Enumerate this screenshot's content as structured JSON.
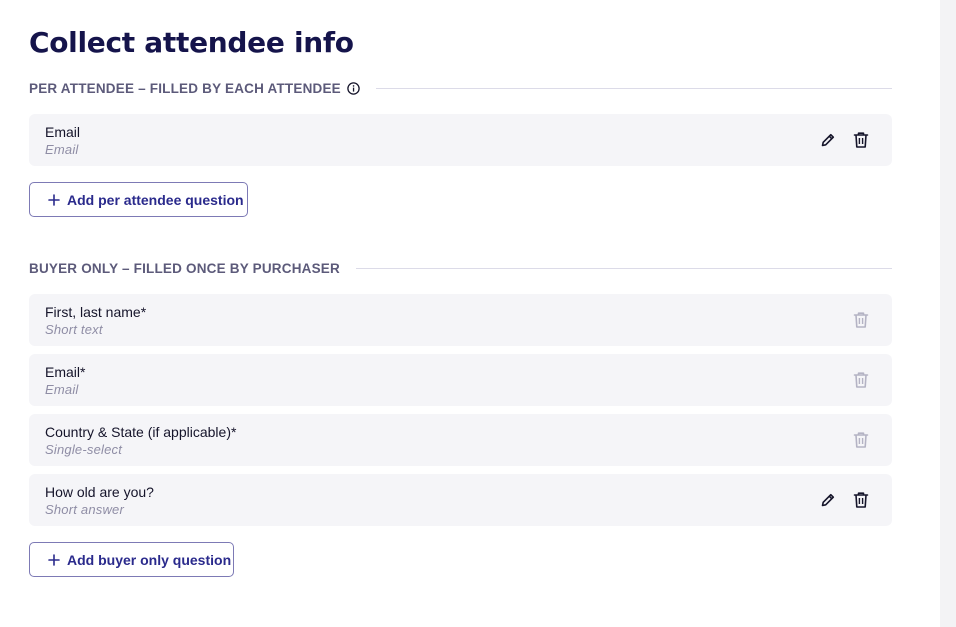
{
  "page": {
    "title": "Collect attendee info"
  },
  "per_attendee": {
    "section_label": "PER ATTENDEE – FILLED BY EACH ATTENDEE",
    "info_icon": "info-circle-icon",
    "questions": [
      {
        "title": "Email",
        "type": "Email",
        "editable": true,
        "deletable": true
      }
    ],
    "add_button_label": "Add per attendee question"
  },
  "buyer_only": {
    "section_label": "BUYER ONLY – FILLED ONCE BY PURCHASER",
    "questions": [
      {
        "title": "First, last name*",
        "type": "Short text",
        "editable": false,
        "deletable": false
      },
      {
        "title": "Email*",
        "type": "Email",
        "editable": false,
        "deletable": false
      },
      {
        "title": "Country & State (if applicable)*",
        "type": "Single-select",
        "editable": false,
        "deletable": false
      },
      {
        "title": "How old are you?",
        "type": "Short answer",
        "editable": true,
        "deletable": true
      }
    ],
    "add_button_label": "Add buyer only question"
  },
  "colors": {
    "title": "#15144b",
    "section_label": "#5c5a7a",
    "card_bg": "#f5f5f8",
    "icon_active": "#15142a",
    "icon_disabled": "#b4b3c4",
    "button_border": "#7d7ab5",
    "button_text": "#2a2a8c"
  }
}
